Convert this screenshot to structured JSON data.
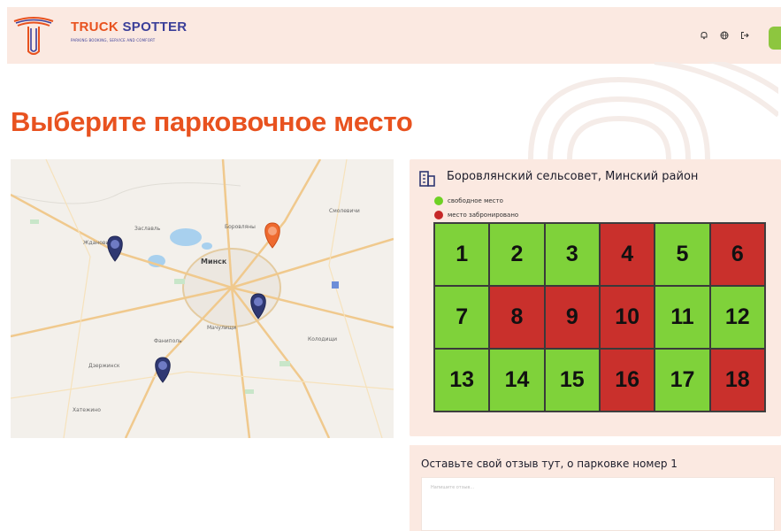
{
  "brand": {
    "name_part1": "TRUCK",
    "name_part2": "SPOTTER",
    "tagline": "PARKING BOOKING, SERVICE AND COMFORT"
  },
  "header": {
    "icons": [
      "bell-icon",
      "globe-icon",
      "logout-icon"
    ]
  },
  "page": {
    "title": "Выберите парковочное место"
  },
  "map": {
    "labels": [
      "Минск",
      "Заславль",
      "Боровляны",
      "Фаниполь",
      "Смолевичи",
      "Дзержинск",
      "Мачулищи",
      "Колодищи",
      "Ждановичи",
      "Хатежино"
    ],
    "markers": [
      {
        "name": "map-marker",
        "state": "default"
      },
      {
        "name": "map-marker-selected",
        "state": "selected"
      },
      {
        "name": "map-marker",
        "state": "default"
      },
      {
        "name": "map-marker",
        "state": "default"
      }
    ]
  },
  "parking": {
    "location": "Боровлянский сельсовет, Минский район",
    "legend": {
      "free": "свободное место",
      "busy": "место забронировано"
    },
    "spots": [
      {
        "number": "1",
        "status": "free"
      },
      {
        "number": "2",
        "status": "free"
      },
      {
        "number": "3",
        "status": "free"
      },
      {
        "number": "4",
        "status": "busy"
      },
      {
        "number": "5",
        "status": "free"
      },
      {
        "number": "6",
        "status": "busy"
      },
      {
        "number": "7",
        "status": "free"
      },
      {
        "number": "8",
        "status": "busy"
      },
      {
        "number": "9",
        "status": "busy"
      },
      {
        "number": "10",
        "status": "busy"
      },
      {
        "number": "11",
        "status": "free"
      },
      {
        "number": "12",
        "status": "free"
      },
      {
        "number": "13",
        "status": "free"
      },
      {
        "number": "14",
        "status": "free"
      },
      {
        "number": "15",
        "status": "free"
      },
      {
        "number": "16",
        "status": "busy"
      },
      {
        "number": "17",
        "status": "free"
      },
      {
        "number": "18",
        "status": "busy"
      }
    ],
    "colors": {
      "free": "#7fd23a",
      "busy": "#c9302c"
    }
  },
  "review": {
    "title": "Оставьте свой отзыв тут, о парковке номер 1",
    "placeholder": "Напишите отзыв..."
  },
  "colors": {
    "accent": "#e8521f",
    "brand_blue": "#3b3f99",
    "panel_bg": "#fbe9e1"
  }
}
